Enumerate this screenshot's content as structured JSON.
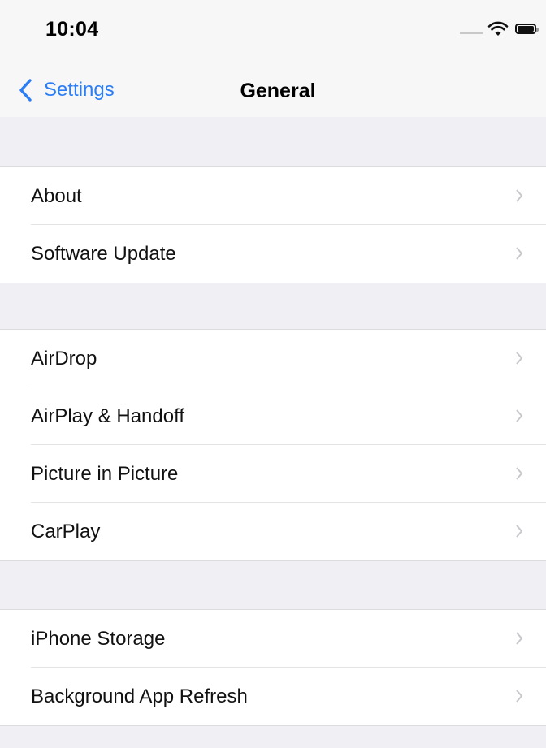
{
  "status_bar": {
    "time": "10:04"
  },
  "nav": {
    "back_label": "Settings",
    "title": "General"
  },
  "groups": [
    {
      "items": [
        {
          "label": "About"
        },
        {
          "label": "Software Update"
        }
      ]
    },
    {
      "items": [
        {
          "label": "AirDrop"
        },
        {
          "label": "AirPlay & Handoff"
        },
        {
          "label": "Picture in Picture"
        },
        {
          "label": "CarPlay"
        }
      ]
    },
    {
      "items": [
        {
          "label": "iPhone Storage"
        },
        {
          "label": "Background App Refresh"
        }
      ]
    }
  ],
  "colors": {
    "accent": "#2b7ef6",
    "background": "#efeff4",
    "chevron": "#c7c7cc"
  }
}
